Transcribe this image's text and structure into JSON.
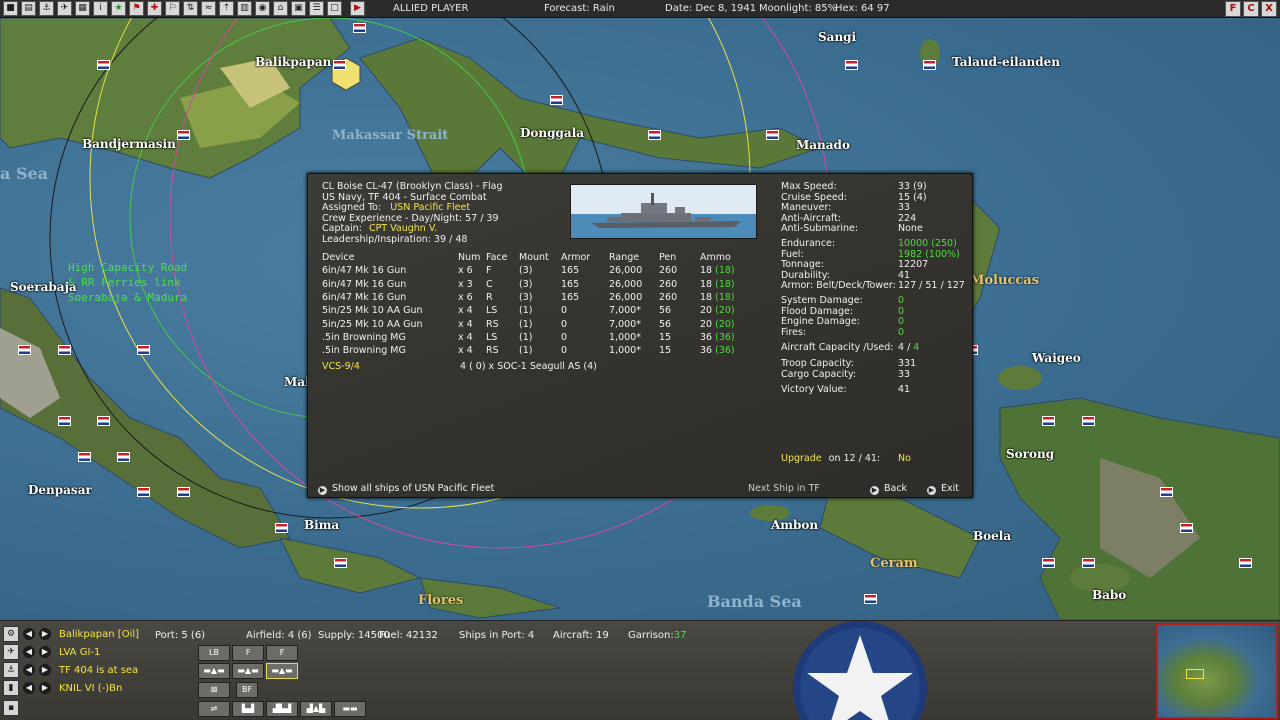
{
  "toolbar": {
    "player": "ALLIED PLAYER",
    "forecast": "Forecast: Rain",
    "date": "Date: Dec 8, 1941",
    "moonlight": "Moonlight: 85%",
    "hex": "Hex: 64 97",
    "right_buttons": [
      "F",
      "C",
      "X"
    ]
  },
  "map": {
    "places": [
      "Sangi",
      "Talaud-eilanden",
      "Balikpapan",
      "Bandjermasin",
      "Donggala",
      "Manado",
      "Soerabaja",
      "Waigeo",
      "Sorong",
      "Denpasar",
      "Bima",
      "Ambon",
      "Boela",
      "Babo",
      "Mak"
    ],
    "seas": [
      "a Sea",
      "Makassar Strait",
      "Banda Sea"
    ],
    "regions": [
      "Moluccas",
      "Ceram",
      "Flores"
    ],
    "note": "High Capacity Road\n& RR Ferries link\nSoerabaja & Madura"
  },
  "ship": {
    "title": "CL Boise CL-47 (Brooklyn Class)  - Flag",
    "tf": "US Navy, TF 404 - Surface Combat",
    "assigned_label": "Assigned To:",
    "assigned_value": "USN Pacific Fleet",
    "crew": "Crew Experience - Day/Night:  57 / 39",
    "captain_label": "Captain:",
    "captain_value": "CPT Vaughn V.",
    "leadership": "Leadership/Inspiration:  39 / 48"
  },
  "device_table": {
    "headers": [
      "Device",
      "Num",
      "Face",
      "Mount",
      "Armor",
      "Range",
      "Pen",
      "Ammo"
    ],
    "rows": [
      {
        "device": "6in/47 Mk 16 Gun",
        "num": "x 6",
        "face": "F",
        "mount": "(3)",
        "armor": "165",
        "range": "26,000",
        "pen": "260",
        "ammo": "18",
        "ammo_max": "(18)"
      },
      {
        "device": "6in/47 Mk 16 Gun",
        "num": "x 3",
        "face": "C",
        "mount": "(3)",
        "armor": "165",
        "range": "26,000",
        "pen": "260",
        "ammo": "18",
        "ammo_max": "(18)"
      },
      {
        "device": "6in/47 Mk 16 Gun",
        "num": "x 6",
        "face": "R",
        "mount": "(3)",
        "armor": "165",
        "range": "26,000",
        "pen": "260",
        "ammo": "18",
        "ammo_max": "(18)"
      },
      {
        "device": "5in/25 Mk 10 AA Gun",
        "num": "x 4",
        "face": "LS",
        "mount": "(1)",
        "armor": "0",
        "range": "7,000*",
        "pen": "56",
        "ammo": "20",
        "ammo_max": "(20)"
      },
      {
        "device": "5in/25 Mk 10 AA Gun",
        "num": "x 4",
        "face": "RS",
        "mount": "(1)",
        "armor": "0",
        "range": "7,000*",
        "pen": "56",
        "ammo": "20",
        "ammo_max": "(20)"
      },
      {
        "device": ".5in Browning MG",
        "num": "x 4",
        "face": "LS",
        "mount": "(1)",
        "armor": "0",
        "range": "1,000*",
        "pen": "15",
        "ammo": "36",
        "ammo_max": "(36)"
      },
      {
        "device": ".5in Browning MG",
        "num": "x 4",
        "face": "RS",
        "mount": "(1)",
        "armor": "0",
        "range": "1,000*",
        "pen": "15",
        "ammo": "36",
        "ammo_max": "(36)"
      }
    ]
  },
  "air_group": {
    "name": "VCS-9/4",
    "desc": "4 ( 0) x SOC-1 Seagull AS (4)"
  },
  "stats": {
    "max_speed": {
      "label": "Max Speed:",
      "value": "33 (9)"
    },
    "cruise_speed": {
      "label": "Cruise Speed:",
      "value": "15 (4)"
    },
    "maneuver": {
      "label": "Maneuver:",
      "value": "33"
    },
    "anti_aircraft": {
      "label": "Anti-Aircraft:",
      "value": "224"
    },
    "anti_sub": {
      "label": "Anti-Submarine:",
      "value": "None"
    },
    "endurance": {
      "label": "Endurance:",
      "value": "10000 (250)"
    },
    "fuel": {
      "label": "Fuel:",
      "value": "1982 (100%)"
    },
    "tonnage": {
      "label": "Tonnage:",
      "value": "12207"
    },
    "durability": {
      "label": "Durability:",
      "value": "41"
    },
    "armor": {
      "label": "Armor: Belt/Deck/Tower:",
      "value": "127 / 51 / 127"
    },
    "system_damage": {
      "label": "System Damage:",
      "value": "0"
    },
    "flood_damage": {
      "label": "Flood Damage:",
      "value": "0"
    },
    "engine_damage": {
      "label": "Engine Damage:",
      "value": "0"
    },
    "fires": {
      "label": "Fires:",
      "value": "0"
    },
    "aircraft_capacity": {
      "label": "Aircraft Capacity /Used:",
      "value_a": "4 /",
      "value_b": "4"
    },
    "troop_capacity": {
      "label": "Troop Capacity:",
      "value": "331"
    },
    "cargo_capacity": {
      "label": "Cargo Capacity:",
      "value": "33"
    },
    "victory_value": {
      "label": "Victory Value:",
      "value": "41"
    }
  },
  "upgrade": {
    "label": "Upgrade",
    "date": "on 12 / 41:",
    "value": "No"
  },
  "dialog_buttons": {
    "show_all": "Show all ships of USN Pacific Fleet",
    "next_ship": "Next Ship in TF",
    "back": "Back",
    "exit": "Exit"
  },
  "bottom": {
    "rows": [
      {
        "label": "Balikpapan [Oil]"
      },
      {
        "label": "LVA GI-1"
      },
      {
        "label": "TF 404 is at sea"
      },
      {
        "label": "KNIL VI (-)Bn"
      }
    ],
    "port": "Port: 5 (6)",
    "airfield": "Airfield: 4 (6)",
    "supply": "Supply: 14500",
    "fuel": "Fuel: 42132",
    "ships_in_port": "Ships in Port: 4",
    "aircraft": "Aircraft: 19",
    "garrison_label": "Garrison:",
    "garrison_value": "37",
    "unit_buttons": [
      "LB",
      "F",
      "F",
      "BF"
    ]
  }
}
